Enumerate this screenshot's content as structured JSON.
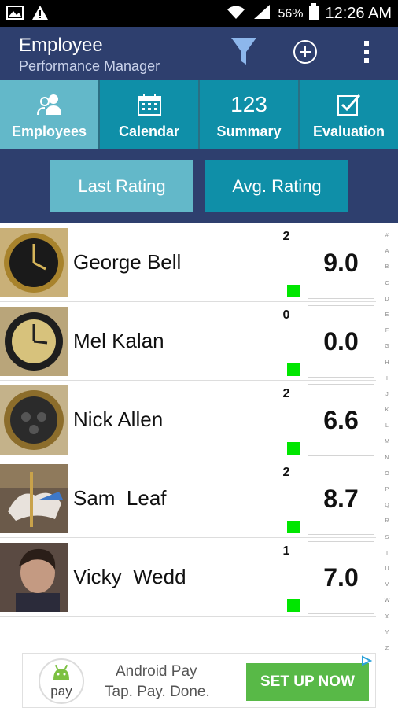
{
  "status_bar": {
    "battery_percent": "56%",
    "time": "12:26 AM"
  },
  "app_bar": {
    "title": "Employee",
    "subtitle": "Performance Manager"
  },
  "tabs": [
    {
      "label": "Employees",
      "icon": "people-icon",
      "active": true
    },
    {
      "label": "Calendar",
      "icon": "calendar-icon",
      "active": false
    },
    {
      "label": "Summary",
      "icon": "numbers-icon",
      "icon_text": "123",
      "active": false
    },
    {
      "label": "Evaluation",
      "icon": "checkbox-icon",
      "active": false
    }
  ],
  "sort": {
    "last_rating_label": "Last Rating",
    "avg_rating_label": "Avg. Rating"
  },
  "employees": [
    {
      "name": "George Bell",
      "count": "2",
      "score": "9.0",
      "photo": "gold-watch"
    },
    {
      "name": "Mel Kalan",
      "count": "0",
      "score": "0.0",
      "photo": "gold-watch"
    },
    {
      "name": "Nick Allen",
      "count": "2",
      "score": "6.6",
      "photo": "dark-watch"
    },
    {
      "name": "Sam  Leaf",
      "count": "2",
      "score": "8.7",
      "photo": "carousel-horse"
    },
    {
      "name": "Vicky  Wedd",
      "count": "1",
      "score": "7.0",
      "photo": "woman-portrait"
    }
  ],
  "index_letters": [
    "#",
    "A",
    "B",
    "C",
    "D",
    "E",
    "F",
    "G",
    "H",
    "I",
    "J",
    "K",
    "L",
    "M",
    "N",
    "O",
    "P",
    "Q",
    "R",
    "S",
    "T",
    "U",
    "V",
    "W",
    "X",
    "Y",
    "Z"
  ],
  "ad": {
    "logo_text": "pay",
    "line1": "Android Pay",
    "line2": "Tap. Pay. Done.",
    "cta": "SET UP NOW"
  },
  "colors": {
    "app_bar": "#2e3f6e",
    "tab_bar": "#0f8fa8",
    "tab_active": "#63b8c9",
    "status_dot": "#00e600",
    "cta_green": "#58b947"
  }
}
